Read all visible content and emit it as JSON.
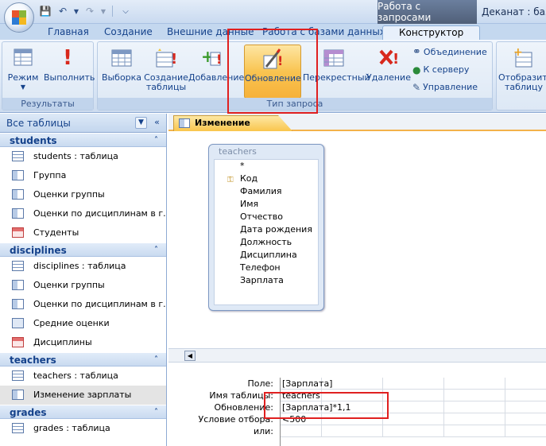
{
  "titlebar": {
    "context_label": "Работа с запросами",
    "app_title": "Деканат : база"
  },
  "tabs": [
    "Главная",
    "Создание",
    "Внешние данные",
    "Работа с базами данных",
    "Конструктор"
  ],
  "ribbon": {
    "results_group": {
      "label": "Результаты",
      "mode": "Режим",
      "run": "Выполнить"
    },
    "query_type_group": {
      "label": "Тип запроса",
      "select": "Выборка",
      "make_table": "Создание таблицы",
      "append": "Добавление",
      "update": "Обновление",
      "crosstab": "Перекрестный",
      "delete": "Удаление",
      "union": "Объединение",
      "passthrough": "К серверу",
      "ddl": "Управление"
    },
    "show_table": "Отобразить таблицу"
  },
  "nav": {
    "title": "Все таблицы",
    "sections": [
      {
        "name": "students",
        "items": [
          {
            "label": "students : таблица",
            "icon": "table"
          },
          {
            "label": "Группа",
            "icon": "query"
          },
          {
            "label": "Оценки группы",
            "icon": "query"
          },
          {
            "label": "Оценки по дисциплинам в г...",
            "icon": "query"
          },
          {
            "label": "Студенты",
            "icon": "form"
          }
        ]
      },
      {
        "name": "disciplines",
        "items": [
          {
            "label": "disciplines : таблица",
            "icon": "table"
          },
          {
            "label": "Оценки группы",
            "icon": "query"
          },
          {
            "label": "Оценки по дисциплинам в г...",
            "icon": "query"
          },
          {
            "label": "Средние оценки",
            "icon": "report"
          },
          {
            "label": "Дисциплины",
            "icon": "form"
          }
        ]
      },
      {
        "name": "teachers",
        "items": [
          {
            "label": "teachers : таблица",
            "icon": "table"
          },
          {
            "label": "Изменение зарплаты",
            "icon": "query",
            "selected": true
          }
        ]
      },
      {
        "name": "grades",
        "items": [
          {
            "label": "grades : таблица",
            "icon": "table"
          }
        ]
      }
    ]
  },
  "document": {
    "tab_label": "Изменение зарплаты",
    "table_box": {
      "title": "teachers",
      "fields": [
        "*",
        "Код",
        "Фамилия",
        "Имя",
        "Отчество",
        "Дата рождения",
        "Должность",
        "Дисциплина",
        "Телефон",
        "Зарплата"
      ]
    },
    "grid": {
      "row_labels": [
        "Поле:",
        "Имя таблицы:",
        "Обновление:",
        "Условие отбора:",
        "или:"
      ],
      "column1": [
        "[Зарплата]",
        "teachers",
        "[Зарплата]*1,1",
        "<500",
        ""
      ]
    }
  }
}
